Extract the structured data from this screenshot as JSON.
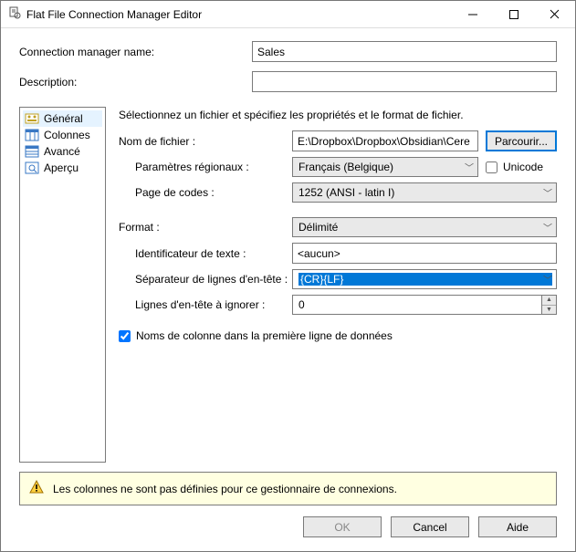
{
  "window": {
    "title": "Flat File Connection Manager Editor"
  },
  "top": {
    "conn_label": "Connection manager name:",
    "conn_value": "Sales",
    "desc_label": "Description:",
    "desc_value": ""
  },
  "nav": {
    "items": [
      {
        "label": "Général"
      },
      {
        "label": "Colonnes"
      },
      {
        "label": "Avancé"
      },
      {
        "label": "Aperçu"
      }
    ]
  },
  "panel": {
    "instruction": "Sélectionnez un fichier et spécifiez les propriétés et le format de fichier.",
    "filename_label": "Nom de fichier :",
    "filename_value": "E:\\Dropbox\\Dropbox\\Obsidian\\Cere",
    "browse_label": "Parcourir...",
    "locale_label": "Paramètres régionaux :",
    "locale_value": "Français (Belgique)",
    "unicode_label": "Unicode",
    "unicode_checked": false,
    "codepage_label": "Page de codes :",
    "codepage_value": "1252  (ANSI - latin I)",
    "format_label": "Format :",
    "format_value": "Délimité",
    "textqual_label": "Identificateur de texte :",
    "textqual_value": "<aucun>",
    "hdrsep_label": "Séparateur de lignes d'en-tête :",
    "hdrsep_value": "{CR}{LF}",
    "skip_label": "Lignes d'en-tête à ignorer :",
    "skip_value": "0",
    "firstrow_label": "Noms de colonne dans la première ligne de données",
    "firstrow_checked": true
  },
  "warning": {
    "text": "Les colonnes ne sont pas définies pour ce gestionnaire de connexions."
  },
  "buttons": {
    "ok": "OK",
    "cancel": "Cancel",
    "help": "Aide"
  }
}
